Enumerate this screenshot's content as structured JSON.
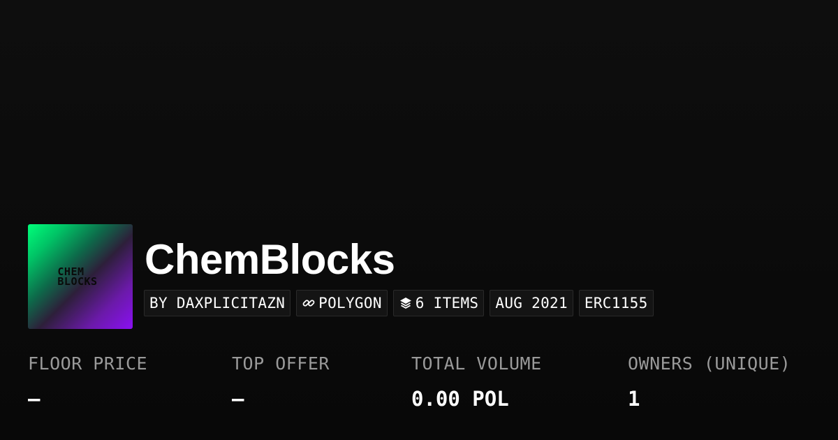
{
  "collection": {
    "name": "ChemBlocks",
    "avatar_text": [
      "CHEM",
      "BLOCKS"
    ]
  },
  "chips": {
    "creator": "BY DAXPLICITAZN",
    "chain": "POLYGON",
    "chain_icon": "link-icon",
    "items": "6 ITEMS",
    "items_icon": "layers-icon",
    "date": "AUG 2021",
    "standard": "ERC1155"
  },
  "stats": {
    "floor_price": {
      "label": "FLOOR PRICE",
      "value": "–"
    },
    "top_offer": {
      "label": "TOP OFFER",
      "value": "–"
    },
    "total_volume": {
      "label": "TOTAL VOLUME",
      "value": "0.00 POL"
    },
    "owners": {
      "label": "OWNERS (UNIQUE)",
      "value": "1"
    }
  },
  "colors": {
    "background": "#0b0b0b",
    "label": "#9a9a9a",
    "avatar_green": "#00ff7a",
    "avatar_purple": "#8a10f2"
  }
}
